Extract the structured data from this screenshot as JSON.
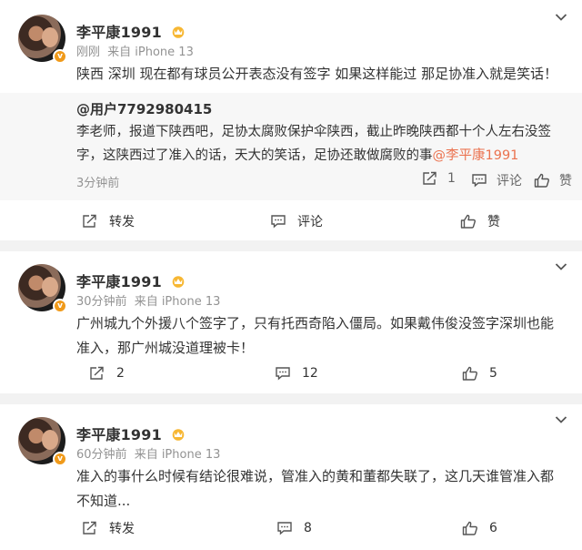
{
  "posts": [
    {
      "author": "李平康1991",
      "time": "刚刚",
      "source": "来自 iPhone 13",
      "text": "陕西 深圳 现在都有球员公开表态没有签字 如果这样能过 那足协准入就是笑话！",
      "repost": {
        "user": "@用户7792980415",
        "text_main": "李老师，报道下陕西吧，足协太腐败保护伞陕西，截止昨晚陕西都十个人左右没签字，这陕西过了准入的话，天大的笑话，足协还敢做腐败的事",
        "mention": "@李平康1991",
        "time": "3分钟前",
        "repost_count": "1",
        "comment_label": "评论",
        "like_label": "赞"
      },
      "actions": {
        "repost": "转发",
        "comment": "评论",
        "like": "赞"
      }
    },
    {
      "author": "李平康1991",
      "time": "30分钟前",
      "source": "来自 iPhone 13",
      "text": "广州城九个外援八个签字了，只有托西奇陷入僵局。如果戴伟俊没签字深圳也能准入，那广州城没道理被卡！",
      "actions": {
        "repost": "2",
        "comment": "12",
        "like": "5"
      }
    },
    {
      "author": "李平康1991",
      "time": "60分钟前",
      "source": "来自 iPhone 13",
      "text": "准入的事什么时候有结论很难说，管准入的黄和董都失联了，这几天谁管准入都不知道...",
      "actions": {
        "repost": "转发",
        "comment": "8",
        "like": "6"
      }
    }
  ],
  "colors": {
    "mention": "#eb7350",
    "badge": "#f09a1a",
    "meta": "#939393"
  },
  "icons": [
    "verified-badge-icon",
    "vip-crown-icon",
    "chevron-down-icon",
    "repost-icon",
    "comment-icon",
    "like-icon"
  ]
}
